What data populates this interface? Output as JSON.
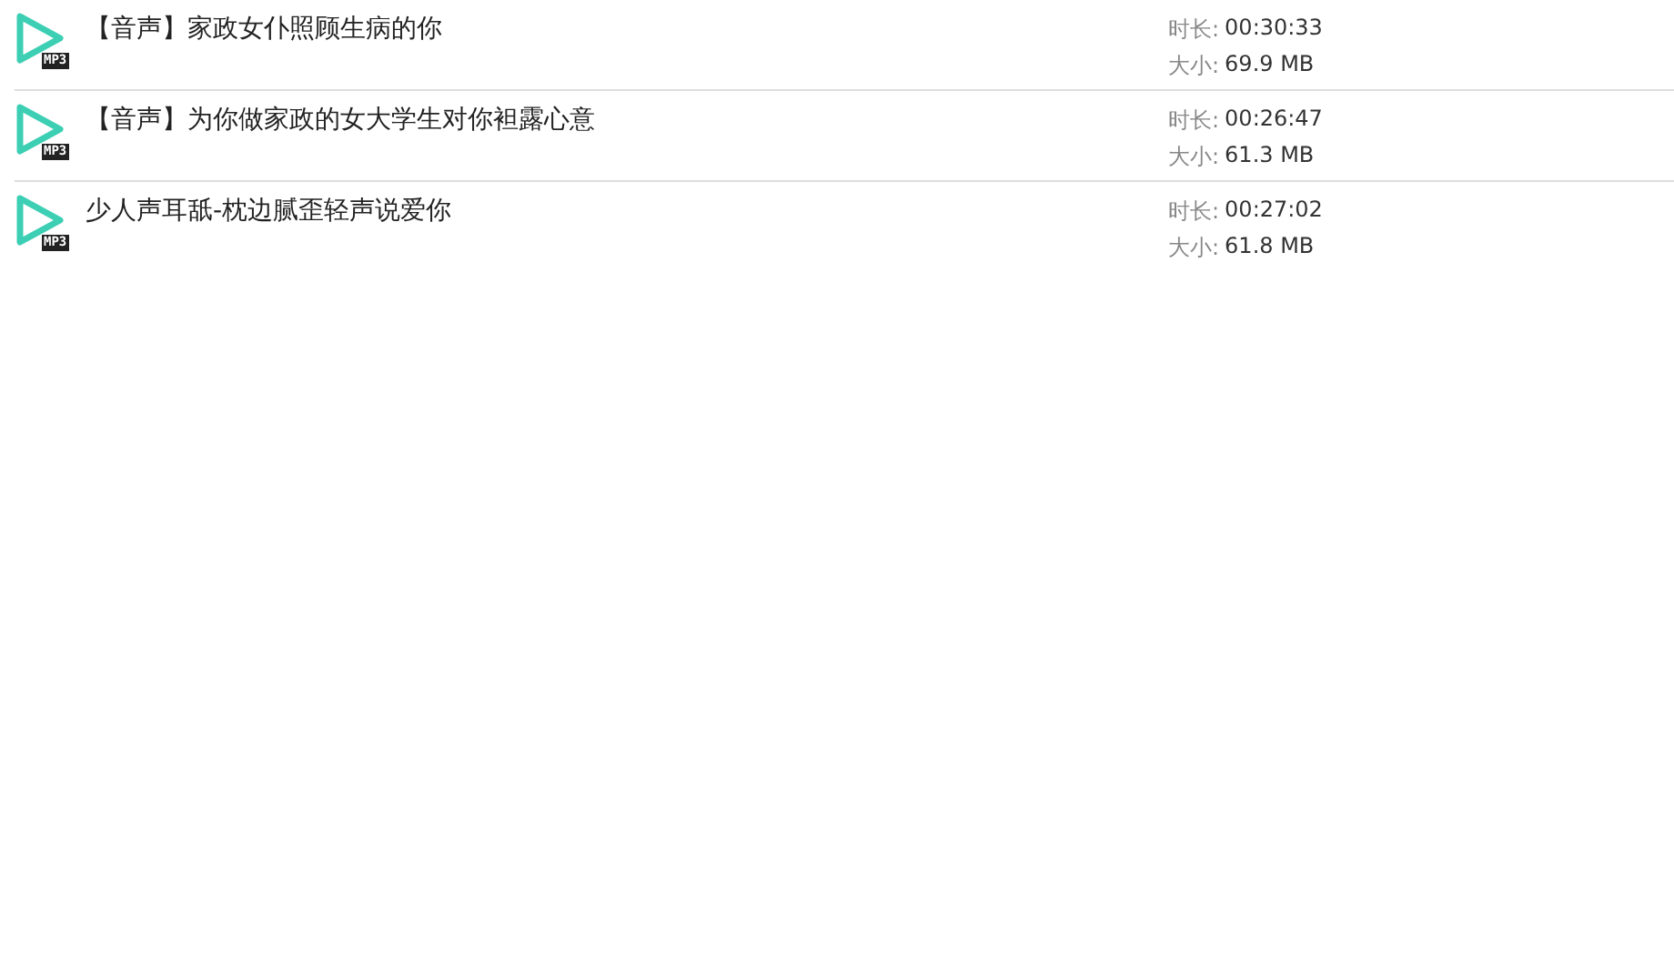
{
  "files": [
    {
      "title": "【音声】家政女仆照顾生病的你",
      "badge": "MP3",
      "duration_label": "时长:",
      "duration": "00:30:33",
      "size_label": "大小:",
      "size": "69.9 MB"
    },
    {
      "title": "【音声】为你做家政的女大学生对你袒露心意",
      "badge": "MP3",
      "duration_label": "时长:",
      "duration": "00:26:47",
      "size_label": "大小:",
      "size": "61.3 MB"
    },
    {
      "title": "少人声耳舐-枕边腻歪轻声说爱你",
      "badge": "MP3",
      "duration_label": "时长:",
      "duration": "00:27:02",
      "size_label": "大小:",
      "size": "61.8 MB"
    }
  ]
}
